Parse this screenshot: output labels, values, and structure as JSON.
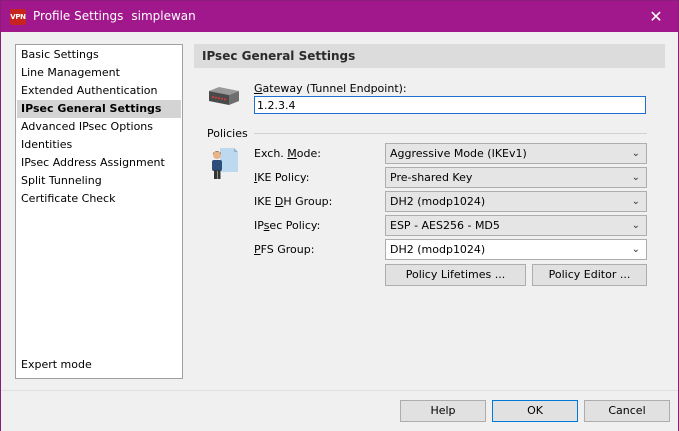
{
  "window": {
    "app_icon_text": "VPN",
    "title": "Profile Settings",
    "profile_name": "simplewan",
    "close_glyph": "✕",
    "title_color": "#a1178c"
  },
  "nav": {
    "items": [
      {
        "label": "Basic Settings",
        "selected": false
      },
      {
        "label": "Line Management",
        "selected": false
      },
      {
        "label": "Extended Authentication",
        "selected": false
      },
      {
        "label": "IPsec General Settings",
        "selected": true
      },
      {
        "label": "Advanced IPsec Options",
        "selected": false
      },
      {
        "label": "Identities",
        "selected": false
      },
      {
        "label": "IPsec Address Assignment",
        "selected": false
      },
      {
        "label": "Split Tunneling",
        "selected": false
      },
      {
        "label": "Certificate Check",
        "selected": false
      }
    ],
    "expert_mode": "Expert mode"
  },
  "header": {
    "title": "IPsec General Settings"
  },
  "gateway": {
    "label_u": "G",
    "label_rest": "ateway (Tunnel Endpoint):",
    "value": "1.2.3.4",
    "icon": "router-icon"
  },
  "policies": {
    "section_label": "Policies",
    "icon": "user-document-icon",
    "exch_mode": {
      "label_pre": "Exch. ",
      "label_u": "M",
      "label_post": "ode:",
      "value": "Aggressive Mode (IKEv1)"
    },
    "ike_policy": {
      "label_pre": "",
      "label_u": "I",
      "label_post": "KE Policy:",
      "value": "Pre-shared Key"
    },
    "ike_dh_group": {
      "label_pre": "IKE ",
      "label_u": "D",
      "label_post": "H Group:",
      "value": "DH2 (modp1024)"
    },
    "ipsec_policy": {
      "label_pre": "IP",
      "label_u": "s",
      "label_post": "ec Policy:",
      "value": "ESP - AES256 - MD5"
    },
    "pfs_group": {
      "label_pre": "",
      "label_u": "P",
      "label_post": "FS Group:",
      "value": "DH2 (modp1024)"
    },
    "lifetimes_button": "Policy Lifetimes ...",
    "editor_button": "Policy Editor ..."
  },
  "footer": {
    "help": "Help",
    "ok": "OK",
    "cancel": "Cancel"
  }
}
